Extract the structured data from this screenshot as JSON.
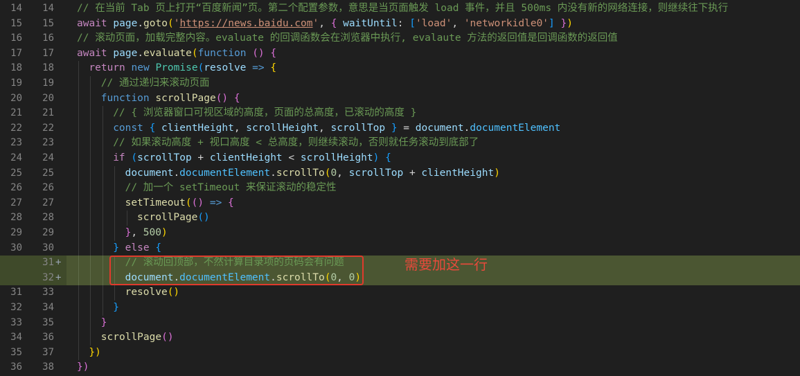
{
  "annotation": {
    "text": "需要加这一行",
    "color": "#e84a3b"
  },
  "lines": [
    {
      "old": "14",
      "new": "14",
      "marker": "",
      "indent": 0,
      "tokens": [
        [
          "comment",
          "// 在当前 Tab 页上打开“百度新闻”页。第二个配置参数，意思是当页面触发 load 事件，并且 500ms 内没有新的网络连接，则继续往下执行"
        ]
      ]
    },
    {
      "old": "15",
      "new": "15",
      "marker": "",
      "indent": 0,
      "tokens": [
        [
          "control",
          "await"
        ],
        [
          "plain",
          " "
        ],
        [
          "variable",
          "page"
        ],
        [
          "plain",
          "."
        ],
        [
          "function",
          "goto"
        ],
        [
          "bracket1",
          "("
        ],
        [
          "string",
          "'"
        ],
        [
          "link",
          "https://news.baidu.com"
        ],
        [
          "string",
          "'"
        ],
        [
          "plain",
          ", "
        ],
        [
          "bracket2",
          "{"
        ],
        [
          "plain",
          " "
        ],
        [
          "variable",
          "waitUntil"
        ],
        [
          "plain",
          ": "
        ],
        [
          "bracket3",
          "["
        ],
        [
          "string",
          "'load'"
        ],
        [
          "plain",
          ", "
        ],
        [
          "string",
          "'networkidle0'"
        ],
        [
          "bracket3",
          "]"
        ],
        [
          "plain",
          " "
        ],
        [
          "bracket2",
          "}"
        ],
        [
          "bracket1",
          ")"
        ]
      ]
    },
    {
      "old": "16",
      "new": "16",
      "marker": "",
      "indent": 0,
      "tokens": [
        [
          "comment",
          "// 滚动页面，加载完整内容。evaluate 的回调函数会在浏览器中执行, evalaute 方法的返回值是回调函数的返回值"
        ]
      ]
    },
    {
      "old": "17",
      "new": "17",
      "marker": "",
      "indent": 0,
      "tokens": [
        [
          "control",
          "await"
        ],
        [
          "plain",
          " "
        ],
        [
          "variable",
          "page"
        ],
        [
          "plain",
          "."
        ],
        [
          "function",
          "evaluate"
        ],
        [
          "bracket1",
          "("
        ],
        [
          "keyword",
          "function"
        ],
        [
          "plain",
          " "
        ],
        [
          "bracket2",
          "()"
        ],
        [
          "plain",
          " "
        ],
        [
          "bracket2",
          "{"
        ]
      ]
    },
    {
      "old": "18",
      "new": "18",
      "marker": "",
      "indent": 1,
      "tokens": [
        [
          "control",
          "return"
        ],
        [
          "plain",
          " "
        ],
        [
          "keyword",
          "new"
        ],
        [
          "plain",
          " "
        ],
        [
          "class",
          "Promise"
        ],
        [
          "bracket3",
          "("
        ],
        [
          "variable",
          "resolve"
        ],
        [
          "plain",
          " "
        ],
        [
          "keyword",
          "=>"
        ],
        [
          "plain",
          " "
        ],
        [
          "bracket1",
          "{"
        ]
      ]
    },
    {
      "old": "19",
      "new": "19",
      "marker": "",
      "indent": 2,
      "tokens": [
        [
          "comment",
          "// 通过递归来滚动页面"
        ]
      ]
    },
    {
      "old": "20",
      "new": "20",
      "marker": "",
      "indent": 2,
      "tokens": [
        [
          "keyword",
          "function"
        ],
        [
          "plain",
          " "
        ],
        [
          "function",
          "scrollPage"
        ],
        [
          "bracket2",
          "()"
        ],
        [
          "plain",
          " "
        ],
        [
          "bracket2",
          "{"
        ]
      ]
    },
    {
      "old": "21",
      "new": "21",
      "marker": "",
      "indent": 3,
      "tokens": [
        [
          "comment",
          "// { 浏览器窗口可视区域的高度，页面的总高度，已滚动的高度 }"
        ]
      ]
    },
    {
      "old": "22",
      "new": "22",
      "marker": "",
      "indent": 3,
      "tokens": [
        [
          "keyword",
          "const"
        ],
        [
          "plain",
          " "
        ],
        [
          "bracket3",
          "{"
        ],
        [
          "plain",
          " "
        ],
        [
          "variable",
          "clientHeight"
        ],
        [
          "plain",
          ", "
        ],
        [
          "variable",
          "scrollHeight"
        ],
        [
          "plain",
          ", "
        ],
        [
          "variable",
          "scrollTop"
        ],
        [
          "plain",
          " "
        ],
        [
          "bracket3",
          "}"
        ],
        [
          "plain",
          " = "
        ],
        [
          "variable",
          "document"
        ],
        [
          "plain",
          "."
        ],
        [
          "property",
          "documentElement"
        ]
      ]
    },
    {
      "old": "23",
      "new": "23",
      "marker": "",
      "indent": 3,
      "tokens": [
        [
          "comment",
          "// 如果滚动高度 + 视口高度 < 总高度，则继续滚动，否则就任务滚动到底部了"
        ]
      ]
    },
    {
      "old": "24",
      "new": "24",
      "marker": "",
      "indent": 3,
      "tokens": [
        [
          "control",
          "if"
        ],
        [
          "plain",
          " "
        ],
        [
          "bracket3",
          "("
        ],
        [
          "variable",
          "scrollTop"
        ],
        [
          "plain",
          " + "
        ],
        [
          "variable",
          "clientHeight"
        ],
        [
          "plain",
          " < "
        ],
        [
          "variable",
          "scrollHeight"
        ],
        [
          "bracket3",
          ")"
        ],
        [
          "plain",
          " "
        ],
        [
          "bracket3",
          "{"
        ]
      ]
    },
    {
      "old": "25",
      "new": "25",
      "marker": "",
      "indent": 4,
      "tokens": [
        [
          "variable",
          "document"
        ],
        [
          "plain",
          "."
        ],
        [
          "property",
          "documentElement"
        ],
        [
          "plain",
          "."
        ],
        [
          "function",
          "scrollTo"
        ],
        [
          "bracket1",
          "("
        ],
        [
          "number",
          "0"
        ],
        [
          "plain",
          ", "
        ],
        [
          "variable",
          "scrollTop"
        ],
        [
          "plain",
          " + "
        ],
        [
          "variable",
          "clientHeight"
        ],
        [
          "bracket1",
          ")"
        ]
      ]
    },
    {
      "old": "26",
      "new": "26",
      "marker": "",
      "indent": 4,
      "tokens": [
        [
          "comment",
          "// 加一个 setTimeout 来保证滚动的稳定性"
        ]
      ]
    },
    {
      "old": "27",
      "new": "27",
      "marker": "",
      "indent": 4,
      "tokens": [
        [
          "function",
          "setTimeout"
        ],
        [
          "bracket1",
          "("
        ],
        [
          "bracket2",
          "()"
        ],
        [
          "plain",
          " "
        ],
        [
          "keyword",
          "=>"
        ],
        [
          "plain",
          " "
        ],
        [
          "bracket2",
          "{"
        ]
      ]
    },
    {
      "old": "28",
      "new": "28",
      "marker": "",
      "indent": 5,
      "tokens": [
        [
          "function",
          "scrollPage"
        ],
        [
          "bracket3",
          "()"
        ]
      ]
    },
    {
      "old": "29",
      "new": "29",
      "marker": "",
      "indent": 4,
      "tokens": [
        [
          "bracket2",
          "}"
        ],
        [
          "plain",
          ", "
        ],
        [
          "number",
          "500"
        ],
        [
          "bracket1",
          ")"
        ]
      ]
    },
    {
      "old": "30",
      "new": "30",
      "marker": "",
      "indent": 3,
      "tokens": [
        [
          "bracket3",
          "}"
        ],
        [
          "plain",
          " "
        ],
        [
          "control",
          "else"
        ],
        [
          "plain",
          " "
        ],
        [
          "bracket3",
          "{"
        ]
      ]
    },
    {
      "old": "",
      "new": "31",
      "marker": "+",
      "indent": 4,
      "added": true,
      "tokens": [
        [
          "comment",
          "// 滚动回顶部，不然计算目录项的页码会有问题"
        ]
      ]
    },
    {
      "old": "",
      "new": "32",
      "marker": "+",
      "indent": 4,
      "added": true,
      "tokens": [
        [
          "variable",
          "document"
        ],
        [
          "plain",
          "."
        ],
        [
          "property",
          "documentElement"
        ],
        [
          "plain",
          "."
        ],
        [
          "function",
          "scrollTo"
        ],
        [
          "bracket1",
          "("
        ],
        [
          "number",
          "0"
        ],
        [
          "plain",
          ", "
        ],
        [
          "number",
          "0"
        ],
        [
          "bracket1",
          ")"
        ]
      ]
    },
    {
      "old": "31",
      "new": "33",
      "marker": "",
      "indent": 4,
      "tokens": [
        [
          "function",
          "resolve"
        ],
        [
          "bracket1",
          "()"
        ]
      ]
    },
    {
      "old": "32",
      "new": "34",
      "marker": "",
      "indent": 3,
      "tokens": [
        [
          "bracket3",
          "}"
        ]
      ]
    },
    {
      "old": "33",
      "new": "35",
      "marker": "",
      "indent": 2,
      "tokens": [
        [
          "bracket2",
          "}"
        ]
      ]
    },
    {
      "old": "34",
      "new": "36",
      "marker": "",
      "indent": 2,
      "tokens": [
        [
          "function",
          "scrollPage"
        ],
        [
          "bracket2",
          "()"
        ]
      ]
    },
    {
      "old": "35",
      "new": "37",
      "marker": "",
      "indent": 1,
      "tokens": [
        [
          "bracket1",
          "})"
        ]
      ]
    },
    {
      "old": "36",
      "new": "38",
      "marker": "",
      "indent": 0,
      "tokens": [
        [
          "bracket2",
          "})"
        ]
      ]
    }
  ]
}
